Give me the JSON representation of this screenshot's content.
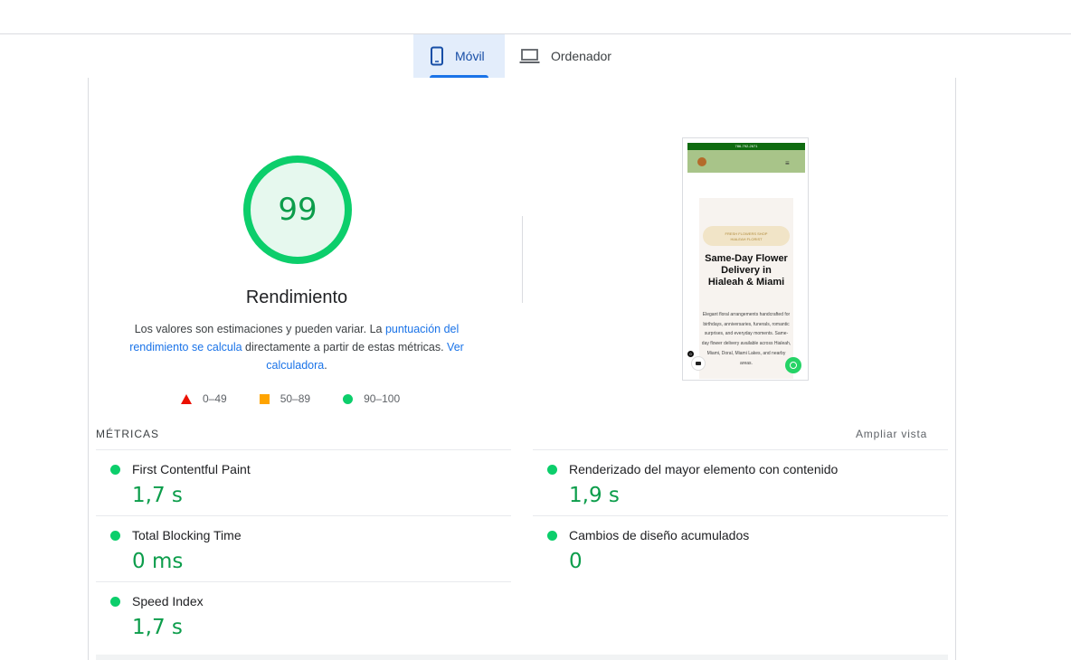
{
  "tabs": [
    {
      "label": "Móvil",
      "icon": "mobile-icon",
      "active": true
    },
    {
      "label": "Ordenador",
      "icon": "laptop-icon",
      "active": false
    }
  ],
  "gauge": {
    "score": "99",
    "title": "Rendimiento",
    "desc_prefix": "Los valores son estimaciones y pueden variar. La ",
    "desc_link1": "puntuación del rendimiento se calcula",
    "desc_middle": " directamente a partir de estas métricas. ",
    "desc_link2": "Ver calculadora",
    "desc_suffix": ".",
    "color": "#0cce6b"
  },
  "legend": [
    {
      "range": "0–49",
      "shape": "triangle",
      "color": "#eb0f00"
    },
    {
      "range": "50–89",
      "shape": "square",
      "color": "#ffa400"
    },
    {
      "range": "90–100",
      "shape": "circle",
      "color": "#0cce6b"
    }
  ],
  "screenshot": {
    "phone": "786-792-2671",
    "pill_line1": "FRESH FLOWERS SHOP",
    "pill_line2": "HIALEAH FLORIST",
    "headline": "Same-Day Flower Delivery in Hialeah & Miami",
    "body": "Elegant floral arrangements handcrafted for birthdays, anniversaries, funerals, romantic surprises, and everyday moments. Same-day flower delivery available across Hialeah, Miami, Doral, Miami Lakes, and nearby areas.",
    "cart_count": "0"
  },
  "metrics": {
    "label": "MÉTRICAS",
    "expand_label": "Ampliar vista",
    "items": [
      {
        "name": "First Contentful Paint",
        "value": "1,7 s",
        "status": "good"
      },
      {
        "name": "Renderizado del mayor elemento con contenido",
        "value": "1,9 s",
        "status": "good"
      },
      {
        "name": "Total Blocking Time",
        "value": "0 ms",
        "status": "good"
      },
      {
        "name": "Cambios de diseño acumulados",
        "value": "0",
        "status": "good"
      },
      {
        "name": "Speed Index",
        "value": "1,7 s",
        "status": "good"
      }
    ]
  }
}
